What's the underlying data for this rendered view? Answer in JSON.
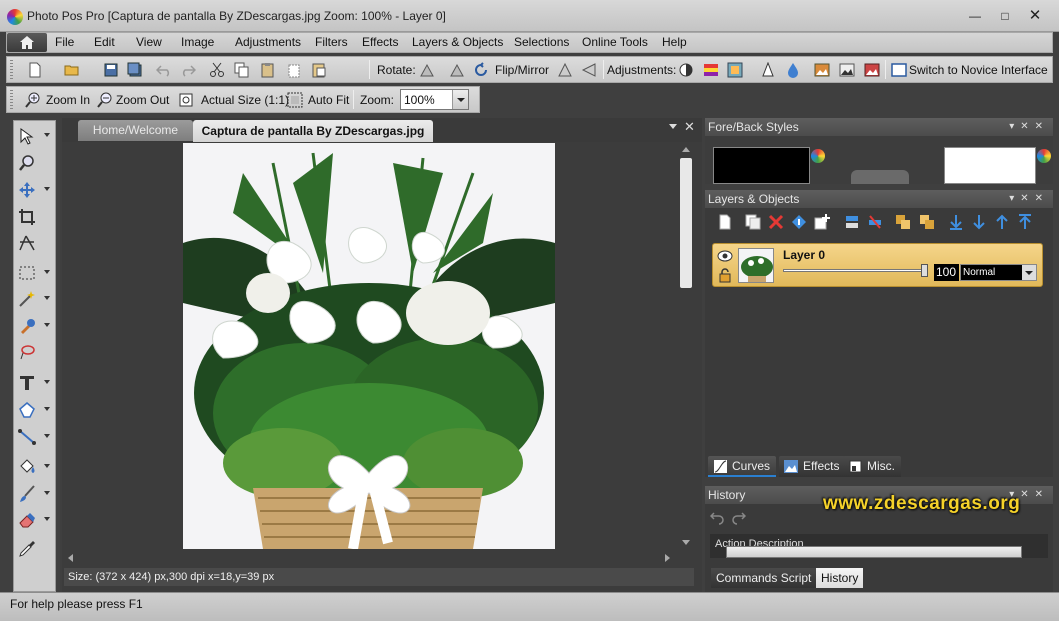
{
  "window": {
    "title": "Photo Pos Pro [Captura de pantalla By ZDescargas.jpg Zoom: 100% - Layer 0]"
  },
  "menu": [
    "File",
    "Edit",
    "View",
    "Image",
    "Adjustments",
    "Filters",
    "Effects",
    "Layers & Objects",
    "Selections",
    "Online Tools",
    "Help"
  ],
  "toolbar1": {
    "rotate_label": "Rotate:",
    "flip_label": "Flip/Mirror",
    "adjustments_label": "Adjustments:",
    "switch_label": "Switch to Novice Interface"
  },
  "toolbar2": {
    "zoom_in": "Zoom In",
    "zoom_out": "Zoom Out",
    "actual_size": "Actual Size (1:1)",
    "auto_fit": "Auto Fit",
    "zoom_label": "Zoom:",
    "zoom_value": "100%"
  },
  "tabs": {
    "home": "Home/Welcome",
    "active": "Captura de pantalla By ZDescargas.jpg"
  },
  "status": {
    "image_info": "Size: (372 x 424) px,300 dpi   x=18,y=39 px",
    "help": "For help please press F1"
  },
  "panels": {
    "fore_back": {
      "title": "Fore/Back Styles",
      "fore_color": "#000000",
      "back_color": "#ffffff"
    },
    "layers": {
      "title": "Layers & Objects",
      "layer_name": "Layer 0",
      "opacity": "100",
      "blend_mode": "Normal",
      "tabs": [
        "Curves",
        "Effects",
        "Misc."
      ]
    },
    "history": {
      "title": "History",
      "item_partial": "Action Description",
      "tabs": [
        "Commands Script",
        "History"
      ]
    }
  },
  "watermark": "www.zdescargas.org",
  "colors": {
    "layer_row": "#e9c46a",
    "dark_bg": "#3c3c3c",
    "watermark": "#f5d22a"
  }
}
